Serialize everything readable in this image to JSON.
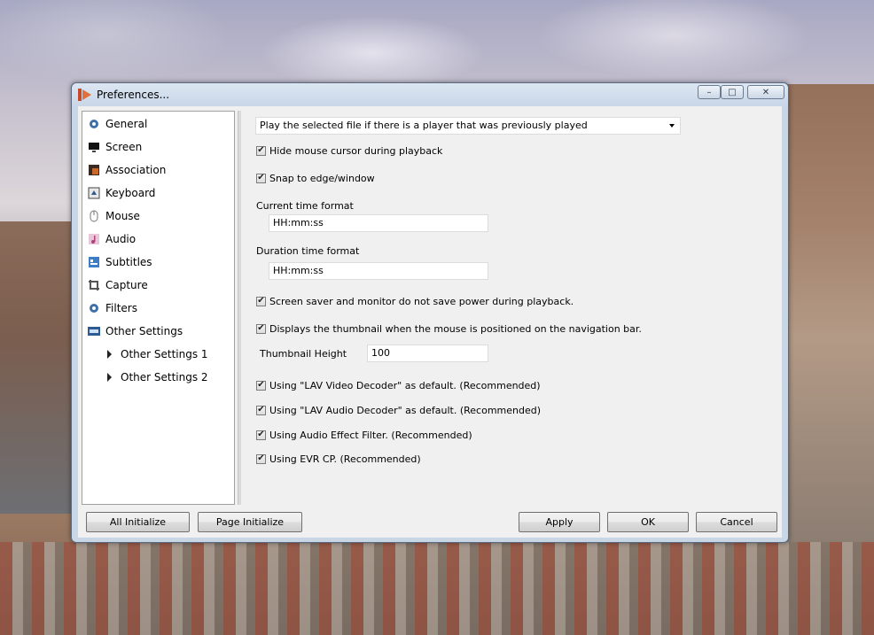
{
  "window": {
    "title": "Preferences...",
    "controls": {
      "minimize": "–",
      "maximize": "□",
      "close": "✕"
    }
  },
  "sidebar": {
    "items": [
      {
        "label": "General",
        "icon": "gear-icon"
      },
      {
        "label": "Screen",
        "icon": "monitor-icon"
      },
      {
        "label": "Association",
        "icon": "file-association-icon"
      },
      {
        "label": "Keyboard",
        "icon": "keyboard-icon"
      },
      {
        "label": "Mouse",
        "icon": "mouse-icon"
      },
      {
        "label": "Audio",
        "icon": "music-note-icon"
      },
      {
        "label": "Subtitles",
        "icon": "subtitles-icon"
      },
      {
        "label": "Capture",
        "icon": "crop-icon"
      },
      {
        "label": "Filters",
        "icon": "gear-icon"
      },
      {
        "label": "Other Settings",
        "icon": "etc-icon"
      }
    ],
    "subitems": [
      {
        "label": "Other Settings 1"
      },
      {
        "label": "Other Settings 2"
      }
    ]
  },
  "panel": {
    "play_mode": {
      "selected": "Play the selected file if there is a player that was previously played"
    },
    "hide_cursor": {
      "label": "Hide mouse cursor during playback",
      "checked": true
    },
    "snap_edge": {
      "label": "Snap to edge/window",
      "checked": true
    },
    "current_time_format": {
      "label": "Current time format",
      "value": "HH:mm:ss"
    },
    "duration_time_format": {
      "label": "Duration time format",
      "value": "HH:mm:ss"
    },
    "screen_saver": {
      "label": "Screen saver and monitor do not save power during playback.",
      "checked": true
    },
    "thumbnail": {
      "label": "Displays the thumbnail when the mouse is positioned on the navigation bar.",
      "checked": true
    },
    "thumbnail_height": {
      "label": "Thumbnail Height",
      "value": "100"
    },
    "lav_video": {
      "label": "Using \"LAV Video Decoder\" as default. (Recommended)",
      "checked": true
    },
    "lav_audio": {
      "label": "Using \"LAV Audio Decoder\" as default. (Recommended)",
      "checked": true
    },
    "audio_effect": {
      "label": "Using Audio Effect Filter. (Recommended)",
      "checked": true
    },
    "evr_cp": {
      "label": "Using EVR CP. (Recommended)",
      "checked": true
    },
    "check_mark": "✔"
  },
  "footer": {
    "all_initialize": "All Initialize",
    "page_initialize": "Page Initialize",
    "apply": "Apply",
    "ok": "OK",
    "cancel": "Cancel"
  },
  "colors": {
    "accent": "#d25a2c",
    "titlebar": "#c8d6e7",
    "client_bg": "#f0f0f0"
  }
}
